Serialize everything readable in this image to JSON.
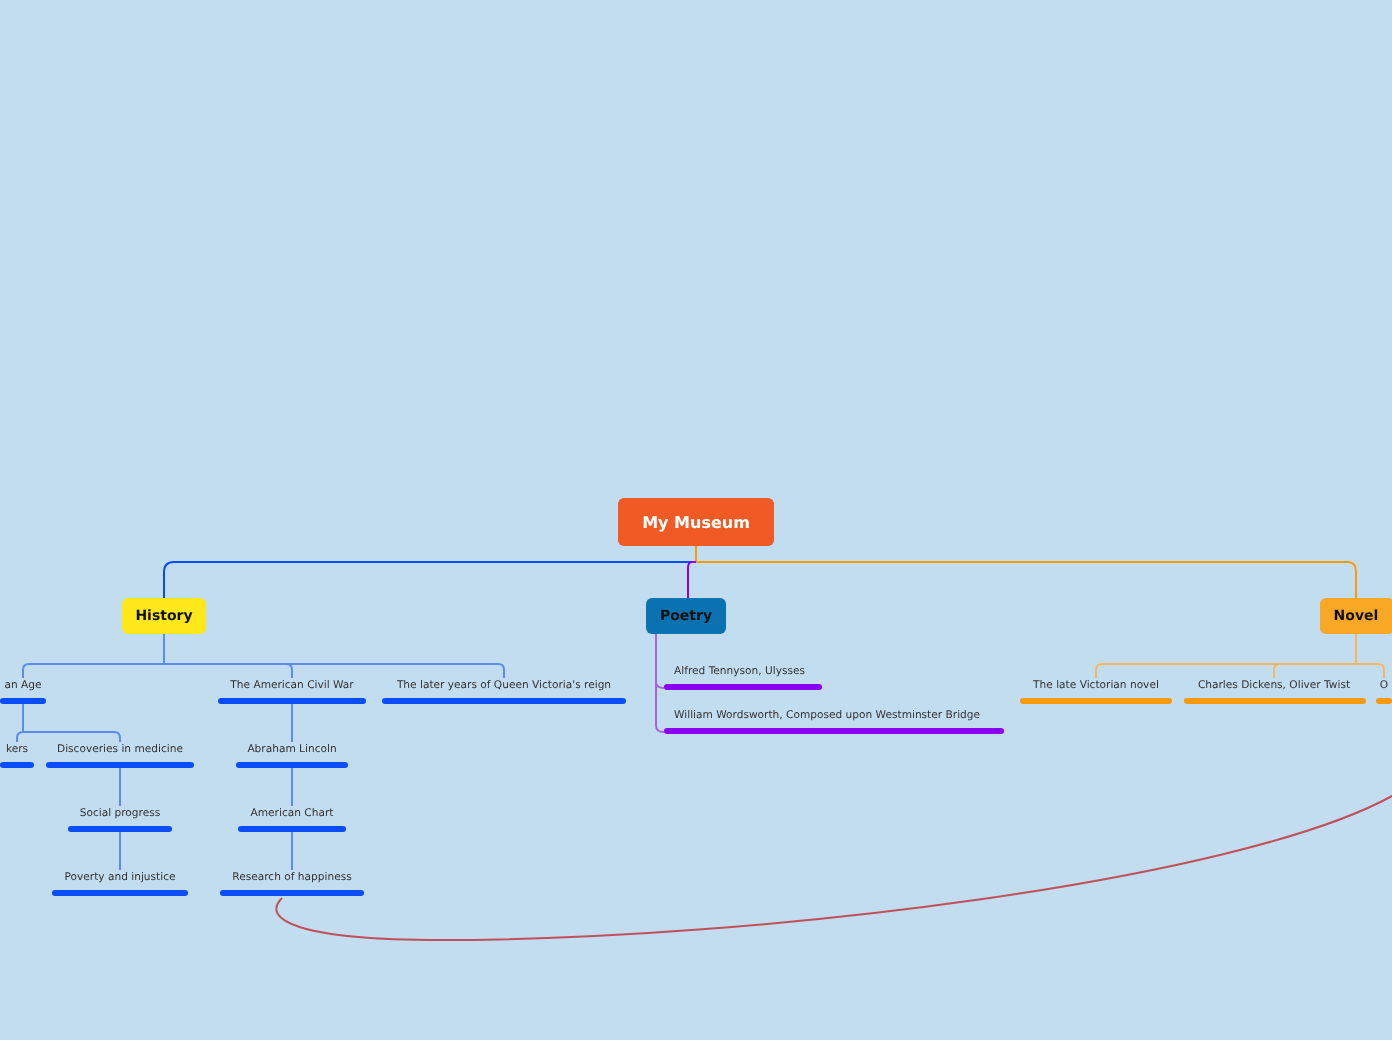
{
  "root": {
    "label": "My Museum"
  },
  "branches": [
    {
      "label": "History",
      "color": "#ffe81a",
      "children": [
        {
          "label": "an Age",
          "children": [
            {
              "label": "kers"
            },
            {
              "label": "Discoveries in medicine",
              "children": [
                {
                  "label": "Social progress",
                  "children": [
                    {
                      "label": "Poverty and injustice"
                    }
                  ]
                }
              ]
            }
          ]
        },
        {
          "label": "The American Civil War",
          "children": [
            {
              "label": "Abraham Lincoln",
              "children": [
                {
                  "label": "American Chart",
                  "children": [
                    {
                      "label": "Research of happiness"
                    }
                  ]
                }
              ]
            }
          ]
        },
        {
          "label": "The later years of Queen Victoria's reign"
        }
      ]
    },
    {
      "label": "Poetry",
      "color": "#0a72b0",
      "children": [
        {
          "label": "Alfred Tennyson, Ulysses"
        },
        {
          "label": "William Wordsworth, Composed upon Westminster Bridge"
        }
      ]
    },
    {
      "label": "Novel",
      "color": "#f8a825",
      "children": [
        {
          "label": "The late Victorian novel"
        },
        {
          "label": "Charles Dickens, Oliver Twist"
        },
        {
          "label": "O"
        }
      ]
    }
  ]
}
